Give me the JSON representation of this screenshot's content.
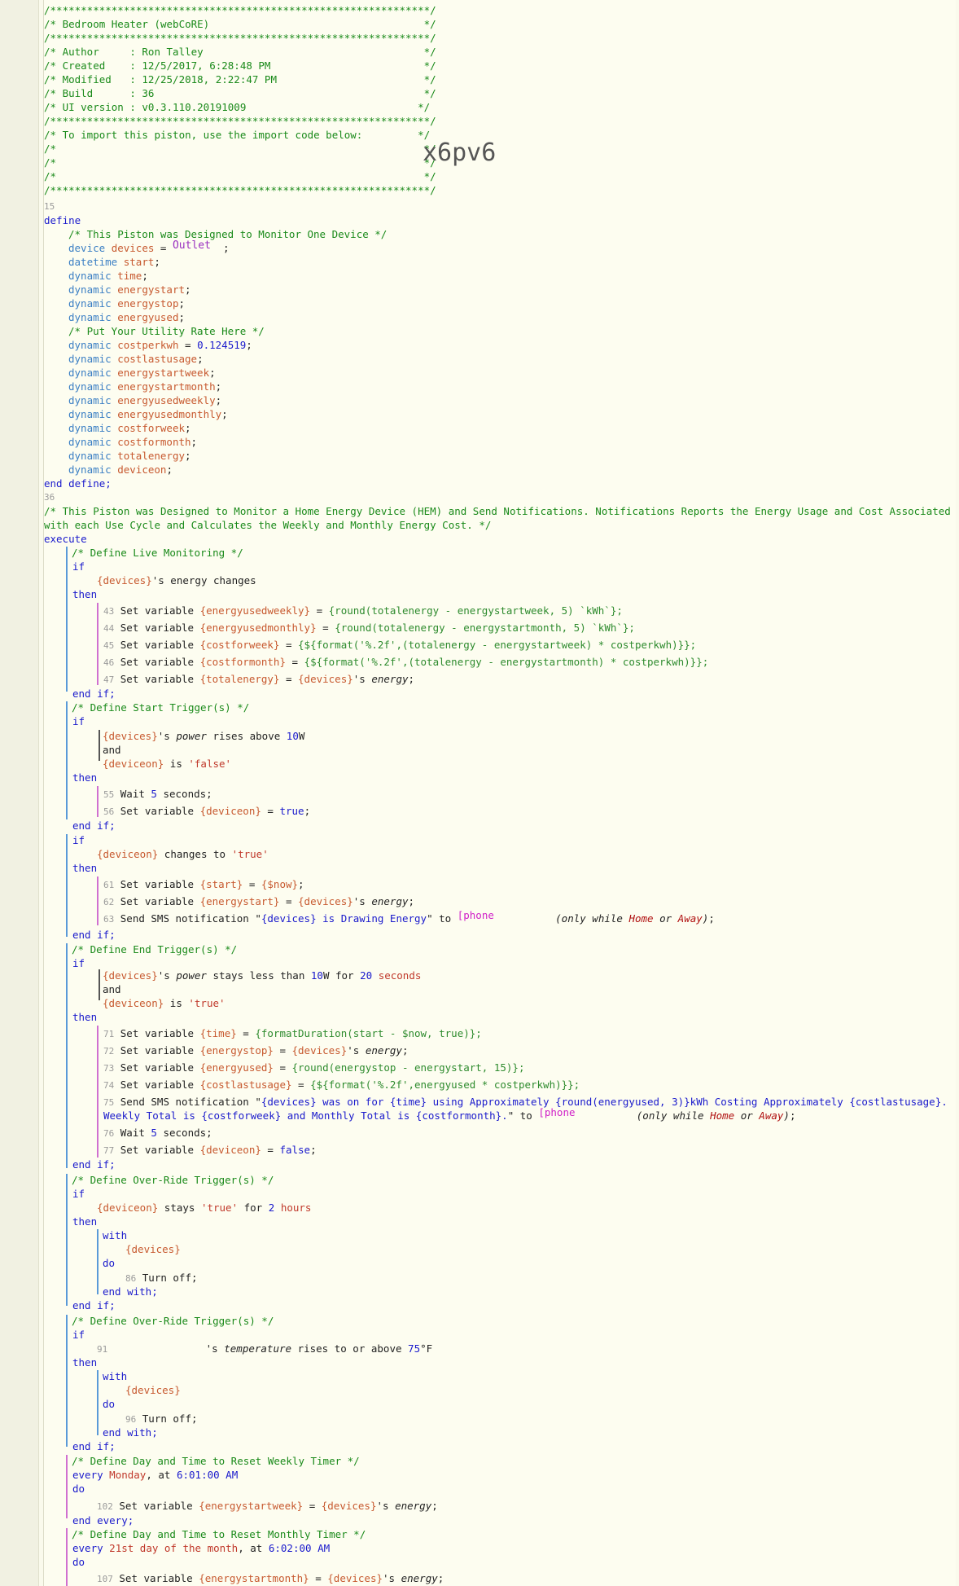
{
  "header": {
    "border": "/**************************************************************/",
    "title": "/* Bedroom Heater (webCoRE)                                   */",
    "author": "/* Author     : Ron Talley                                    */",
    "created": "/* Created    : 12/5/2017, 6:28:48 PM                         */",
    "modified": "/* Modified   : 12/25/2018, 2:22:47 PM                        */",
    "build": "/* Build      : 36                                            */",
    "ui": "/* UI version : v0.3.110.20191009                            */",
    "import": "/* To import this piston, use the import code below:         */",
    "blank": "/*                                                            */",
    "code": "x6pv6"
  },
  "define": {
    "ln": "15",
    "kw": "define",
    "end": "end define;",
    "end_ln": "36",
    "comment1": "/* This Piston was Designed to Monitor One Device */",
    "device_kw": "device",
    "device_var": "devices",
    "device_val": "Outlet",
    "comment2": "/* Put Your Utility Rate Here */",
    "rate": "0.124519"
  },
  "execute": {
    "comment": "/* This Piston was Designed to Monitor a Home Energy Device (HEM) and Send Notifications. Notifications Reports the Energy Usage and Cost Associated",
    "comment_cont": "with each Use Cycle and Calculates the Weekly and Monthly Energy Cost. */",
    "kw": "execute"
  },
  "statements": {
    "live": {
      "comment": "/* Define Live Monitoring */",
      "cond": "'s energy changes",
      "l43": "43",
      "l44": "44",
      "l45": "45",
      "l46": "46",
      "l47": "47",
      "e43": "{round(totalenergy - energystartweek, 5) `kWh`};",
      "e44": "{round(totalenergy - energystartmonth, 5) `kWh`};",
      "e45": "{${format('%.2f',(totalenergy - energystartweek) * costperkwh)}};",
      "e46": "{${format('%.2f',(totalenergy - energystartmonth) * costperkwh)}};"
    },
    "start": {
      "comment": "/* Define Start Trigger(s) */",
      "threshold": "10",
      "l55": "55",
      "l56": "56",
      "wait": "5"
    },
    "change": {
      "cond_str": "'true'",
      "l61": "61",
      "l62": "62",
      "l63": "63",
      "sms": "{devices} is Drawing Energy",
      "phone": "[phone"
    },
    "end": {
      "comment": "/* Define End Trigger(s) */",
      "threshold": "10",
      "duration": "20",
      "l71": "71",
      "l72": "72",
      "l73": "73",
      "l74": "74",
      "l75": "75",
      "l76": "76",
      "l77": "77",
      "e71": "{formatDuration(start - $now, true)};",
      "e73": "{round(energystop - energystart, 15)};",
      "e74": "{${format('%.2f',energyused * costperkwh)}};",
      "sms1": "{devices} was on for {time} using Approximately {round(energyused, 3)}kWh Costing Approximately {costlastusage}.",
      "sms2": "Weekly Total is {costforweek} and Monthly Total is {costformonth}.",
      "phone": "[phone"
    },
    "override1": {
      "comment": "/* Define Over-Ride Trigger(s) */",
      "hours": "2",
      "l86": "86"
    },
    "override2": {
      "comment": "/* Define Over-Ride Trigger(s) */",
      "l91": "91",
      "temp": "75",
      "l96": "96"
    },
    "weekly": {
      "comment": "/* Define Day and Time to Reset Weekly Timer */",
      "day": "Monday",
      "time": "6:01:00 AM",
      "l102": "102"
    },
    "monthly": {
      "comment": "/* Define Day and Time to Reset Monthly Timer */",
      "day": "21st day of the month",
      "time": "6:02:00 AM",
      "l107": "107"
    }
  },
  "colors": {
    "comment": "#1a8a1a",
    "keyword": "#1a1acc",
    "variable": "#c7592f",
    "string": "#c0392b",
    "background": "#fdfdf0"
  }
}
